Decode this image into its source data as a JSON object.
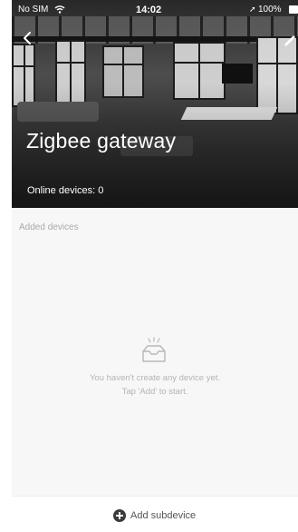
{
  "status_bar": {
    "carrier": "No SIM",
    "time": "14:02",
    "location_icon": "location-arrow-icon",
    "battery": "100%"
  },
  "header": {
    "back_icon": "chevron-left-icon",
    "edit_icon": "pencil-icon",
    "title": "Zigbee gateway",
    "online_label": "Online devices:",
    "online_count": "0"
  },
  "devices": {
    "section_label": "Added devices",
    "empty_icon": "empty-inbox-icon",
    "empty_line1": "You haven't create any device yet.",
    "empty_line2": "Tap 'Add' to start."
  },
  "footer": {
    "add_icon": "plus-circle-icon",
    "add_label": "Add subdevice"
  }
}
